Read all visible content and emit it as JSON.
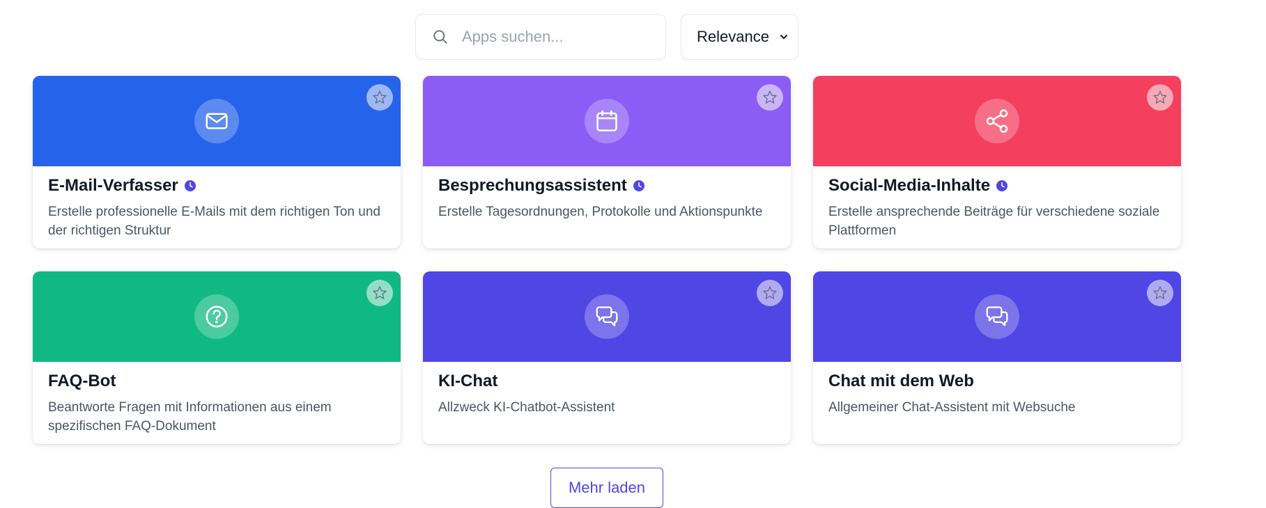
{
  "search": {
    "placeholder": "Apps suchen...",
    "value": ""
  },
  "sort": {
    "selected": "Relevance"
  },
  "colors": {
    "blue": "#2563eb",
    "violet": "#8b5cf6",
    "rose": "#f43f5e",
    "green": "#10b981",
    "indigo": "#4f46e5"
  },
  "cards": [
    {
      "title": "E-Mail-Verfasser",
      "description": "Erstelle professionelle E-Mails mit dem richtigen Ton und der richtigen Struktur",
      "icon": "mail-icon",
      "color": "#2563eb",
      "badge": "clock-icon"
    },
    {
      "title": "Besprechungsassistent",
      "description": "Erstelle Tagesordnungen, Protokolle und Aktionspunkte",
      "icon": "calendar-icon",
      "color": "#8b5cf6",
      "badge": "clock-icon"
    },
    {
      "title": "Social-Media-Inhalte",
      "description": "Erstelle ansprechende Beiträge für verschiedene soziale Plattformen",
      "icon": "share-icon",
      "color": "#f43f5e",
      "badge": "clock-icon"
    },
    {
      "title": "FAQ-Bot",
      "description": "Beantworte Fragen mit Informationen aus einem spezifischen FAQ-Dokument",
      "icon": "question-icon",
      "color": "#10b981"
    },
    {
      "title": "KI-Chat",
      "description": "Allzweck KI-Chatbot-Assistent",
      "icon": "chat-icon",
      "color": "#4f46e5"
    },
    {
      "title": "Chat mit dem Web",
      "description": "Allgemeiner Chat-Assistent mit Websuche",
      "icon": "chat-icon",
      "color": "#4f46e5"
    }
  ],
  "load_more_label": "Mehr laden"
}
